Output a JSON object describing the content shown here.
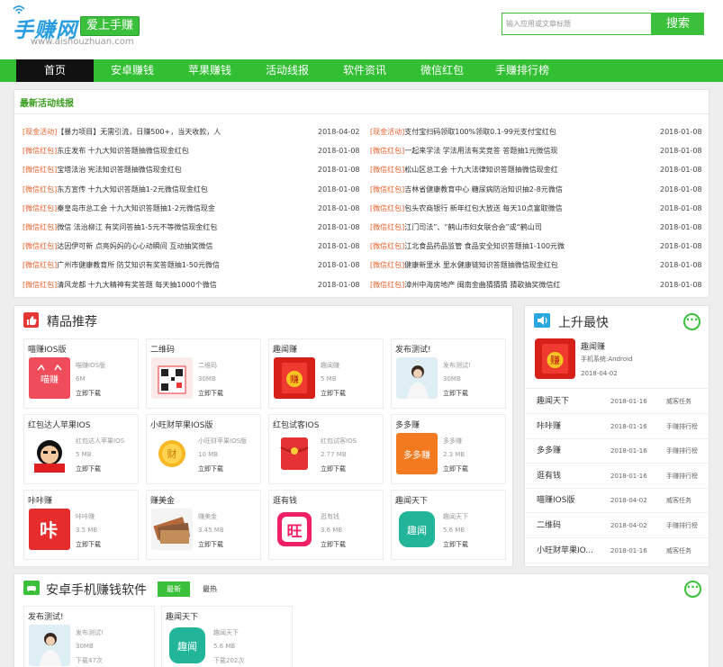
{
  "header": {
    "logo_text": "手赚网",
    "logo_url": "www.aishouzhuan.com",
    "slogan": "爱上手赚",
    "search_placeholder": "输入应用或文章标题",
    "search_button": "搜索"
  },
  "nav": [
    "首页",
    "安卓赚钱",
    "苹果赚钱",
    "活动线报",
    "软件资讯",
    "微信红包",
    "手赚排行榜"
  ],
  "news": {
    "title": "最新活动线报",
    "left": [
      {
        "tag": "[现金活动]",
        "text": "【暴力项目】无需引流，日赚500+，当天收款，人",
        "date": "2018-04-02"
      },
      {
        "tag": "[微信红包]",
        "text": "东庄发布 十九大知识答题抽微信现金红包",
        "date": "2018-01-08"
      },
      {
        "tag": "[微信红包]",
        "text": "宝塔法治 宪法知识答题抽微信现金红包",
        "date": "2018-01-08"
      },
      {
        "tag": "[微信红包]",
        "text": "东方宣传 十九大知识答题抽1-2元微信现金红包",
        "date": "2018-01-08"
      },
      {
        "tag": "[微信红包]",
        "text": "秦皇岛市总工会 十九大知识答题抽1-2元微信现金",
        "date": "2018-01-08"
      },
      {
        "tag": "[微信红包]",
        "text": "微信 法治柳江 有奖问答抽1-5元不等微信现金红包",
        "date": "2018-01-08"
      },
      {
        "tag": "[微信红包]",
        "text": "达因伊可新 点亮妈妈的心心动瞬间 互动抽奖微信",
        "date": "2018-01-08"
      },
      {
        "tag": "[微信红包]",
        "text": "广州市健康教育所 防艾知识有奖答题抽1-50元微信",
        "date": "2018-01-08"
      },
      {
        "tag": "[微信红包]",
        "text": "清风龙都 十九大精神有奖答题 每天抽1000个微信",
        "date": "2018-01-08"
      }
    ],
    "right": [
      {
        "tag": "[现金活动]",
        "text": "支付宝扫码领取100%领取0.1-99元支付宝红包",
        "date": "2018-01-08"
      },
      {
        "tag": "[微信红包]",
        "text": "一起来学法 学法用法有奖竞答 答题抽1元微信现",
        "date": "2018-01-08"
      },
      {
        "tag": "[微信红包]",
        "text": "松山区总工会 十九大法律知识答题抽微信现金红",
        "date": "2018-01-08"
      },
      {
        "tag": "[微信红包]",
        "text": "吉林省健康教育中心 糖尿病防治知识抽2-8元微信",
        "date": "2018-01-08"
      },
      {
        "tag": "[微信红包]",
        "text": "包头农商银行 新年红包大放送 每天10点富取微信",
        "date": "2018-01-08"
      },
      {
        "tag": "[微信红包]",
        "text": "江门司法”、“鹤山市妇女联合会”或“鹤山司",
        "date": "2018-01-08"
      },
      {
        "tag": "[微信红包]",
        "text": "江北食品药品监管 食品安全知识答题抽1-100元微",
        "date": "2018-01-08"
      },
      {
        "tag": "[微信红包]",
        "text": "健康新里水 里水健康链知识答题抽微信现金红包",
        "date": "2018-01-08"
      },
      {
        "tag": "[微信红包]",
        "text": "漳州中海房地产 闽南金曲猜猜猜 猜歌抽奖微信红",
        "date": "2018-01-08"
      }
    ]
  },
  "featured": {
    "title": "精品推荐",
    "download_label": "立即下载",
    "cards": [
      {
        "name": "喵赚IOS版",
        "sub": "喵赚IOS版",
        "size": "6M",
        "icon": "cat-logo-icon"
      },
      {
        "name": "二维码",
        "sub": "二维码",
        "size": "30MB",
        "icon": "qrcode-icon"
      },
      {
        "name": "趣闻赚",
        "sub": "趣闻赚",
        "size": "5 MB",
        "icon": "red-envelope-icon"
      },
      {
        "name": "发布测试!",
        "sub": "发布测试!",
        "size": "30MB",
        "icon": "photo-girl-icon"
      },
      {
        "name": "红包达人苹果IOS",
        "sub": "红包达人苹果IOS",
        "size": "5 MB",
        "icon": "red-envelope-man-icon"
      },
      {
        "name": "小旺财苹果IOS版",
        "sub": "小旺财苹果IOS版",
        "size": "10 MB",
        "icon": "coin-icon"
      },
      {
        "name": "红包试客IOS",
        "sub": "红包试客IOS",
        "size": "2.77 MB",
        "icon": "red-packet-icon"
      },
      {
        "name": "多多赚",
        "sub": "多多赚",
        "size": "2.3 MB",
        "icon": "duoduo-icon"
      },
      {
        "name": "咔咔赚",
        "sub": "咔咔赚",
        "size": "3.5 MB",
        "icon": "kaka-icon"
      },
      {
        "name": "赚美金",
        "sub": "赚美金",
        "size": "3.45 MB",
        "icon": "dollar-bills-icon"
      },
      {
        "name": "逛有钱",
        "sub": "逛有钱",
        "size": "3.6 MB",
        "icon": "wang-icon"
      },
      {
        "name": "趣闻天下",
        "sub": "趣闻天下",
        "size": "5.6 MB",
        "icon": "quwen-icon"
      }
    ]
  },
  "rising": {
    "title": "上升最快",
    "top": {
      "name": "趣闻赚",
      "system": "手机系统:Android",
      "date": "2018-04-02"
    },
    "rows": [
      {
        "name": "趣闻天下",
        "date": "2018-01-16",
        "cat": "威客任务"
      },
      {
        "name": "咔咔赚",
        "date": "2018-01-16",
        "cat": "手赚排行榜"
      },
      {
        "name": "多多赚",
        "date": "2018-01-16",
        "cat": "手赚排行榜"
      },
      {
        "name": "逛有钱",
        "date": "2018-01-16",
        "cat": "手赚排行榜"
      },
      {
        "name": "喵赚IOS版",
        "date": "2018-04-02",
        "cat": "威客任务"
      },
      {
        "name": "二维码",
        "date": "2018-04-02",
        "cat": "手赚排行榜"
      },
      {
        "name": "小旺财苹果IO...",
        "date": "2018-01-16",
        "cat": "威客任务"
      }
    ]
  },
  "android": {
    "title": "安卓手机赚钱软件",
    "tab_new": "最新",
    "tab_hot": "最热",
    "cards": [
      {
        "name": "发布测试!",
        "sub": "发布测试!",
        "size": "30MB",
        "dl": "下载47次"
      },
      {
        "name": "趣闻天下",
        "sub": "趣闻天下",
        "size": "5.6 MB",
        "dl": "下载202次"
      }
    ]
  },
  "colors": {
    "accent": "#33bf33",
    "tag": "#e8612b",
    "nav_active": "#111111"
  }
}
